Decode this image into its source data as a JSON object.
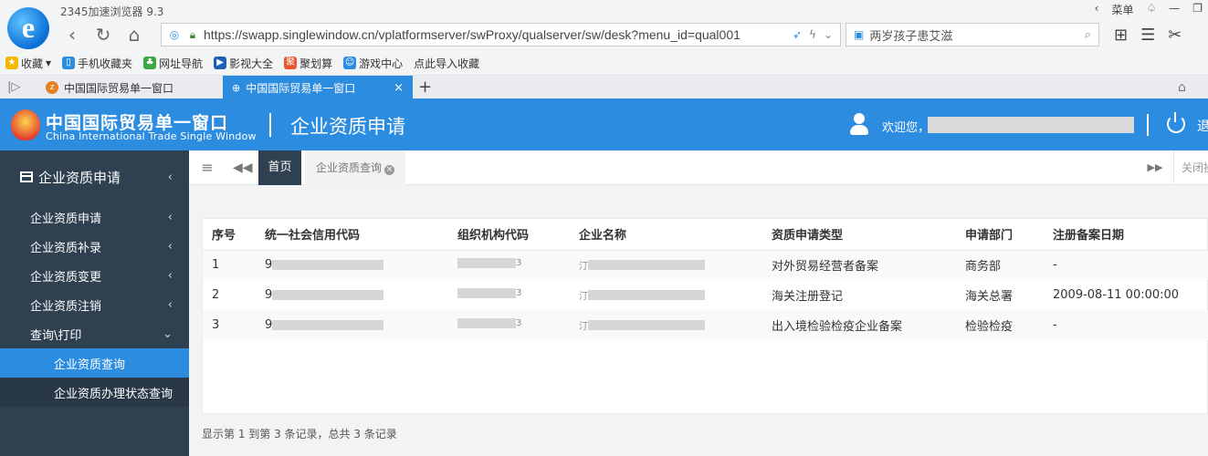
{
  "browser": {
    "title": "2345加速浏览器 9.3",
    "url": "https://swapp.singlewindow.cn/vplatformserver/swProxy/qualserver/sw/desk?menu_id=qual001",
    "search_value": "两岁孩子患艾滋",
    "menu_label": "菜单",
    "bookmarks": [
      "收藏",
      "手机收藏夹",
      "网址导航",
      "影视大全",
      "聚划算",
      "游戏中心",
      "点此导入收藏"
    ],
    "tabs": [
      {
        "label": "中国国际贸易单一窗口",
        "active": false
      },
      {
        "label": "中国国际贸易单一窗口",
        "active": true
      }
    ]
  },
  "header": {
    "brand_cn": "中国国际贸易单一窗口",
    "brand_en": "China International Trade Single Window",
    "page_title": "企业资质申请",
    "welcome": "欢迎您，",
    "logout": "退"
  },
  "sidebar": {
    "title": "企业资质申请",
    "items": [
      {
        "label": "企业资质申请"
      },
      {
        "label": "企业资质补录"
      },
      {
        "label": "企业资质变更"
      },
      {
        "label": "企业资质注销"
      },
      {
        "label": "查询\\打印"
      }
    ],
    "sub_items": [
      {
        "label": "企业资质查询",
        "active": true
      },
      {
        "label": "企业资质办理状态查询",
        "active": false
      }
    ]
  },
  "content": {
    "home_tab": "首页",
    "page_tab": "企业资质查询",
    "close_all": "关闭操作",
    "table": {
      "columns": [
        "序号",
        "统一社会信用代码",
        "组织机构代码",
        "企业名称",
        "资质申请类型",
        "申请部门",
        "注册备案日期"
      ],
      "rows": [
        {
          "no": "1",
          "credit_prefix": "9",
          "org_suffix": "3",
          "name_prefix": "汀",
          "type": "对外贸易经营者备案",
          "dept": "商务部",
          "date": "-"
        },
        {
          "no": "2",
          "credit_prefix": "9",
          "org_suffix": "3",
          "name_prefix": "汀",
          "type": "海关注册登记",
          "dept": "海关总署",
          "date": "2009-08-11 00:00:00"
        },
        {
          "no": "3",
          "credit_prefix": "9",
          "org_suffix": "3",
          "name_prefix": "汀",
          "type": "出入境检验检疫企业备案",
          "dept": "检验检疫",
          "date": "-"
        }
      ]
    },
    "pagination_info": "显示第 1 到第 3 条记录，总共 3 条记录"
  }
}
